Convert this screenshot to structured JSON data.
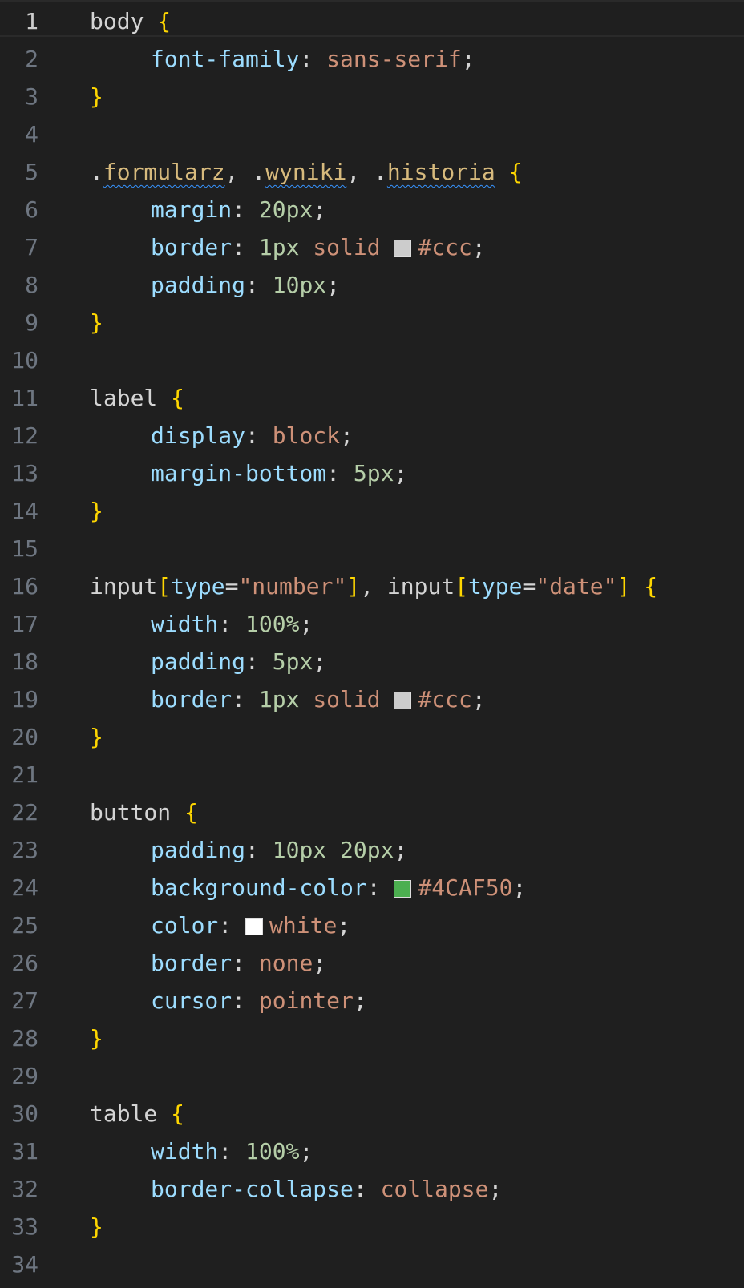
{
  "editor": {
    "language": "CSS",
    "active_line": 1,
    "colors": {
      "background": "#1f1f1f",
      "line_number": "#6e7681",
      "line_number_active": "#cccccc",
      "selector": "#d7ba7d",
      "tag": "#d4d4d4",
      "property": "#9cdcfe",
      "value": "#ce9178",
      "number": "#b5cea8",
      "brace": "#ffd700",
      "punct": "#d4d4d4",
      "attr": "#9cdcfe",
      "string": "#ce9178"
    },
    "lines": [
      {
        "n": "1",
        "tokens": [
          {
            "t": "body",
            "c": "tag"
          },
          {
            "t": " ",
            "c": "punct"
          },
          {
            "t": "{",
            "c": "brace"
          }
        ]
      },
      {
        "n": "2",
        "indent": true,
        "tokens": [
          {
            "t": "font-family",
            "c": "property"
          },
          {
            "t": ": ",
            "c": "punct"
          },
          {
            "t": "sans-serif",
            "c": "value"
          },
          {
            "t": ";",
            "c": "punct"
          }
        ]
      },
      {
        "n": "3",
        "tokens": [
          {
            "t": "}",
            "c": "brace"
          }
        ]
      },
      {
        "n": "4",
        "tokens": []
      },
      {
        "n": "5",
        "tokens": [
          {
            "t": ".",
            "c": "punct"
          },
          {
            "t": "formularz",
            "c": "selector",
            "squiggle": true
          },
          {
            "t": ", .",
            "c": "punct"
          },
          {
            "t": "wyniki",
            "c": "selector",
            "squiggle": true
          },
          {
            "t": ", .",
            "c": "punct"
          },
          {
            "t": "historia",
            "c": "selector",
            "squiggle": true
          },
          {
            "t": " ",
            "c": "punct"
          },
          {
            "t": "{",
            "c": "brace"
          }
        ]
      },
      {
        "n": "6",
        "indent": true,
        "tokens": [
          {
            "t": "margin",
            "c": "property"
          },
          {
            "t": ": ",
            "c": "punct"
          },
          {
            "t": "20px",
            "c": "number"
          },
          {
            "t": ";",
            "c": "punct"
          }
        ]
      },
      {
        "n": "7",
        "indent": true,
        "tokens": [
          {
            "t": "border",
            "c": "property"
          },
          {
            "t": ": ",
            "c": "punct"
          },
          {
            "t": "1px",
            "c": "number"
          },
          {
            "t": " ",
            "c": "punct"
          },
          {
            "t": "solid",
            "c": "value"
          },
          {
            "t": " ",
            "c": "punct"
          },
          {
            "swatch": "#cccccc"
          },
          {
            "t": "#ccc",
            "c": "value"
          },
          {
            "t": ";",
            "c": "punct"
          }
        ]
      },
      {
        "n": "8",
        "indent": true,
        "tokens": [
          {
            "t": "padding",
            "c": "property"
          },
          {
            "t": ": ",
            "c": "punct"
          },
          {
            "t": "10px",
            "c": "number"
          },
          {
            "t": ";",
            "c": "punct"
          }
        ]
      },
      {
        "n": "9",
        "tokens": [
          {
            "t": "}",
            "c": "brace"
          }
        ]
      },
      {
        "n": "10",
        "tokens": []
      },
      {
        "n": "11",
        "tokens": [
          {
            "t": "label",
            "c": "tag"
          },
          {
            "t": " ",
            "c": "punct"
          },
          {
            "t": "{",
            "c": "brace"
          }
        ]
      },
      {
        "n": "12",
        "indent": true,
        "tokens": [
          {
            "t": "display",
            "c": "property"
          },
          {
            "t": ": ",
            "c": "punct"
          },
          {
            "t": "block",
            "c": "value"
          },
          {
            "t": ";",
            "c": "punct"
          }
        ]
      },
      {
        "n": "13",
        "indent": true,
        "tokens": [
          {
            "t": "margin-bottom",
            "c": "property"
          },
          {
            "t": ": ",
            "c": "punct"
          },
          {
            "t": "5px",
            "c": "number"
          },
          {
            "t": ";",
            "c": "punct"
          }
        ]
      },
      {
        "n": "14",
        "tokens": [
          {
            "t": "}",
            "c": "brace"
          }
        ]
      },
      {
        "n": "15",
        "tokens": []
      },
      {
        "n": "16",
        "tokens": [
          {
            "t": "input",
            "c": "tag"
          },
          {
            "t": "[",
            "c": "brace"
          },
          {
            "t": "type",
            "c": "attr"
          },
          {
            "t": "=",
            "c": "punct"
          },
          {
            "t": "\"number\"",
            "c": "string"
          },
          {
            "t": "]",
            "c": "brace"
          },
          {
            "t": ", ",
            "c": "punct"
          },
          {
            "t": "input",
            "c": "tag"
          },
          {
            "t": "[",
            "c": "brace"
          },
          {
            "t": "type",
            "c": "attr"
          },
          {
            "t": "=",
            "c": "punct"
          },
          {
            "t": "\"date\"",
            "c": "string"
          },
          {
            "t": "]",
            "c": "brace"
          },
          {
            "t": " ",
            "c": "punct"
          },
          {
            "t": "{",
            "c": "brace"
          }
        ]
      },
      {
        "n": "17",
        "indent": true,
        "tokens": [
          {
            "t": "width",
            "c": "property"
          },
          {
            "t": ": ",
            "c": "punct"
          },
          {
            "t": "100%",
            "c": "number"
          },
          {
            "t": ";",
            "c": "punct"
          }
        ]
      },
      {
        "n": "18",
        "indent": true,
        "tokens": [
          {
            "t": "padding",
            "c": "property"
          },
          {
            "t": ": ",
            "c": "punct"
          },
          {
            "t": "5px",
            "c": "number"
          },
          {
            "t": ";",
            "c": "punct"
          }
        ]
      },
      {
        "n": "19",
        "indent": true,
        "tokens": [
          {
            "t": "border",
            "c": "property"
          },
          {
            "t": ": ",
            "c": "punct"
          },
          {
            "t": "1px",
            "c": "number"
          },
          {
            "t": " ",
            "c": "punct"
          },
          {
            "t": "solid",
            "c": "value"
          },
          {
            "t": " ",
            "c": "punct"
          },
          {
            "swatch": "#cccccc"
          },
          {
            "t": "#ccc",
            "c": "value"
          },
          {
            "t": ";",
            "c": "punct"
          }
        ]
      },
      {
        "n": "20",
        "tokens": [
          {
            "t": "}",
            "c": "brace"
          }
        ]
      },
      {
        "n": "21",
        "tokens": []
      },
      {
        "n": "22",
        "tokens": [
          {
            "t": "button",
            "c": "tag"
          },
          {
            "t": " ",
            "c": "punct"
          },
          {
            "t": "{",
            "c": "brace"
          }
        ]
      },
      {
        "n": "23",
        "indent": true,
        "tokens": [
          {
            "t": "padding",
            "c": "property"
          },
          {
            "t": ": ",
            "c": "punct"
          },
          {
            "t": "10px",
            "c": "number"
          },
          {
            "t": " ",
            "c": "punct"
          },
          {
            "t": "20px",
            "c": "number"
          },
          {
            "t": ";",
            "c": "punct"
          }
        ]
      },
      {
        "n": "24",
        "indent": true,
        "tokens": [
          {
            "t": "background-color",
            "c": "property"
          },
          {
            "t": ": ",
            "c": "punct"
          },
          {
            "swatch": "#4CAF50"
          },
          {
            "t": "#4CAF50",
            "c": "value"
          },
          {
            "t": ";",
            "c": "punct"
          }
        ]
      },
      {
        "n": "25",
        "indent": true,
        "tokens": [
          {
            "t": "color",
            "c": "property"
          },
          {
            "t": ": ",
            "c": "punct"
          },
          {
            "swatch": "#ffffff"
          },
          {
            "t": "white",
            "c": "value"
          },
          {
            "t": ";",
            "c": "punct"
          }
        ]
      },
      {
        "n": "26",
        "indent": true,
        "tokens": [
          {
            "t": "border",
            "c": "property"
          },
          {
            "t": ": ",
            "c": "punct"
          },
          {
            "t": "none",
            "c": "value"
          },
          {
            "t": ";",
            "c": "punct"
          }
        ]
      },
      {
        "n": "27",
        "indent": true,
        "tokens": [
          {
            "t": "cursor",
            "c": "property"
          },
          {
            "t": ": ",
            "c": "punct"
          },
          {
            "t": "pointer",
            "c": "value"
          },
          {
            "t": ";",
            "c": "punct"
          }
        ]
      },
      {
        "n": "28",
        "tokens": [
          {
            "t": "}",
            "c": "brace"
          }
        ]
      },
      {
        "n": "29",
        "tokens": []
      },
      {
        "n": "30",
        "tokens": [
          {
            "t": "table",
            "c": "tag"
          },
          {
            "t": " ",
            "c": "punct"
          },
          {
            "t": "{",
            "c": "brace"
          }
        ]
      },
      {
        "n": "31",
        "indent": true,
        "tokens": [
          {
            "t": "width",
            "c": "property"
          },
          {
            "t": ": ",
            "c": "punct"
          },
          {
            "t": "100%",
            "c": "number"
          },
          {
            "t": ";",
            "c": "punct"
          }
        ]
      },
      {
        "n": "32",
        "indent": true,
        "tokens": [
          {
            "t": "border-collapse",
            "c": "property"
          },
          {
            "t": ": ",
            "c": "punct"
          },
          {
            "t": "collapse",
            "c": "value"
          },
          {
            "t": ";",
            "c": "punct"
          }
        ]
      },
      {
        "n": "33",
        "tokens": [
          {
            "t": "}",
            "c": "brace"
          }
        ]
      },
      {
        "n": "34",
        "tokens": []
      }
    ]
  }
}
